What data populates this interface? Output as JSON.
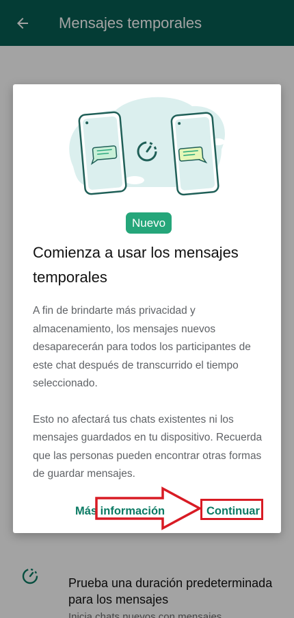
{
  "app_bar": {
    "title": "Mensajes temporales",
    "back_icon": "arrow-back-icon",
    "color": "#075e54"
  },
  "background_item": {
    "title": "Prueba una duración predeterminada para los mensajes",
    "subtitle": "Inicia chats nuevos con mensajes temporales.",
    "icon": "timer-icon"
  },
  "dialog": {
    "badge": "Nuevo",
    "title": "Comienza a usar los mensajes temporales",
    "body_paragraphs": [
      "A fin de brindarte más privacidad y almacenamiento, los mensajes nuevos desaparecerán para todos los participantes de este chat después de transcurrido el tiempo seleccionado.",
      "Esto no afectará tus chats existentes ni los mensajes guardados en tu dispositivo. Recuerda que las personas pueden encontrar otras formas de guardar mensajes."
    ],
    "more_info_label": "Más información",
    "continue_label": "Continuar",
    "accent_color": "#0a7a63",
    "badge_color": "#25a67a"
  },
  "annotation": {
    "arrow_color": "#d81b24",
    "box_color": "#d81b24"
  }
}
